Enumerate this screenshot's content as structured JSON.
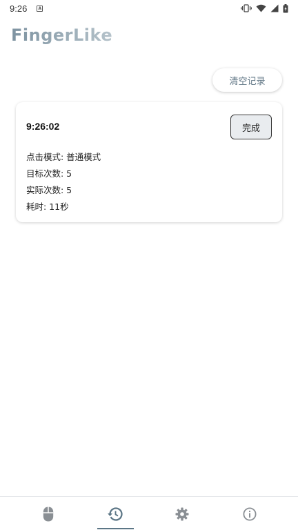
{
  "status_bar": {
    "time": "9:26",
    "notification_letter": "A"
  },
  "app": {
    "title": "FingerLike"
  },
  "toolbar": {
    "clear_label": "清空记录"
  },
  "records": [
    {
      "time": "9:26:02",
      "status_button": "完成",
      "mode": "点击模式: 普通模式",
      "target_count": "目标次数: 5",
      "actual_count": "实际次数: 5",
      "duration": "耗时: 11秒"
    }
  ],
  "nav": {
    "items": [
      "mouse-icon",
      "history-icon",
      "gear-icon",
      "info-icon"
    ],
    "active": "history-icon"
  },
  "colors": {
    "accent": "#5c7686",
    "title_gradient_start": "#7e93a1",
    "title_gradient_end": "#b5c2ca"
  }
}
